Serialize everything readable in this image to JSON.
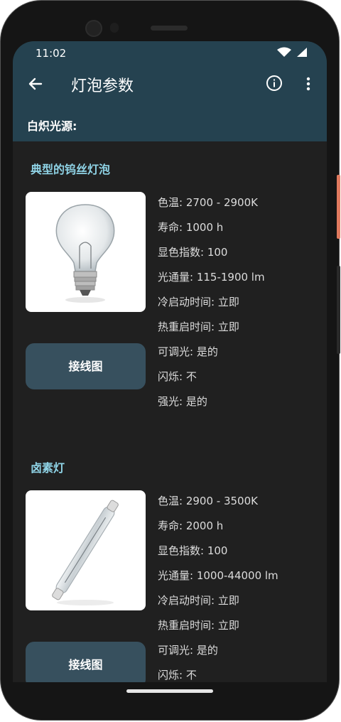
{
  "status_bar": {
    "time": "11:02"
  },
  "app_bar": {
    "title": "灯泡参数"
  },
  "subheader": "白炽光源:",
  "sections": [
    {
      "title": "典型的钨丝灯泡",
      "image": "incandescent-bulb",
      "button_label": "接线图",
      "specs": [
        "色温:  2700 - 2900K",
        "寿命:  1000 h",
        "显色指数:  100",
        "光通量:  115-1900 lm",
        "冷启动时间:  立即",
        "热重启时间:  立即",
        "可调光:  是的",
        "闪烁:  不",
        "强光:  是的"
      ]
    },
    {
      "title": "卤素灯",
      "image": "halogen-tube",
      "button_label": "接线图",
      "specs": [
        "色温:  2900 - 3500K",
        "寿命:  2000 h",
        "显色指数:  100",
        "光通量:  1000-44000 lm",
        "冷启动时间:  立即",
        "热重启时间:  立即",
        "可调光:  是的",
        "闪烁:  不"
      ]
    }
  ],
  "colors": {
    "app_bar": "#254250",
    "background": "#202020",
    "section_title": "#8fd3e6",
    "button": "#37505e"
  }
}
